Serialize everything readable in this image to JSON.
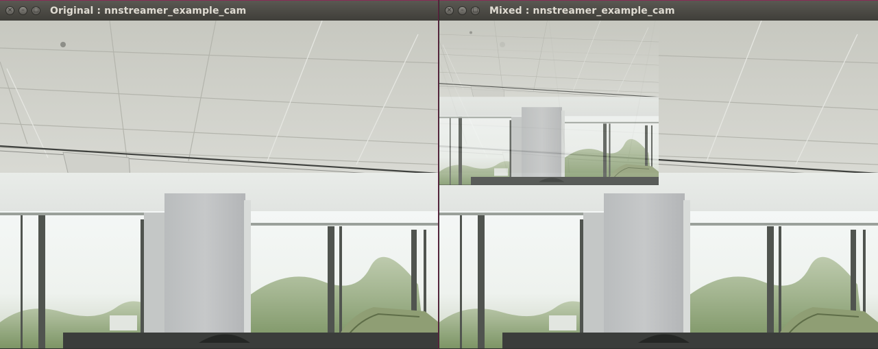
{
  "windows": [
    {
      "title": "Original : nnstreamer_example_cam",
      "controls": {
        "close": "×",
        "minimize": "–",
        "maximize": "□"
      }
    },
    {
      "title": "Mixed : nnstreamer_example_cam",
      "controls": {
        "close": "×",
        "minimize": "–",
        "maximize": "□"
      }
    }
  ],
  "colors": {
    "titlebar": "#4a4944",
    "title_text": "#dfdbd2",
    "window_border": "#8a2a57"
  }
}
